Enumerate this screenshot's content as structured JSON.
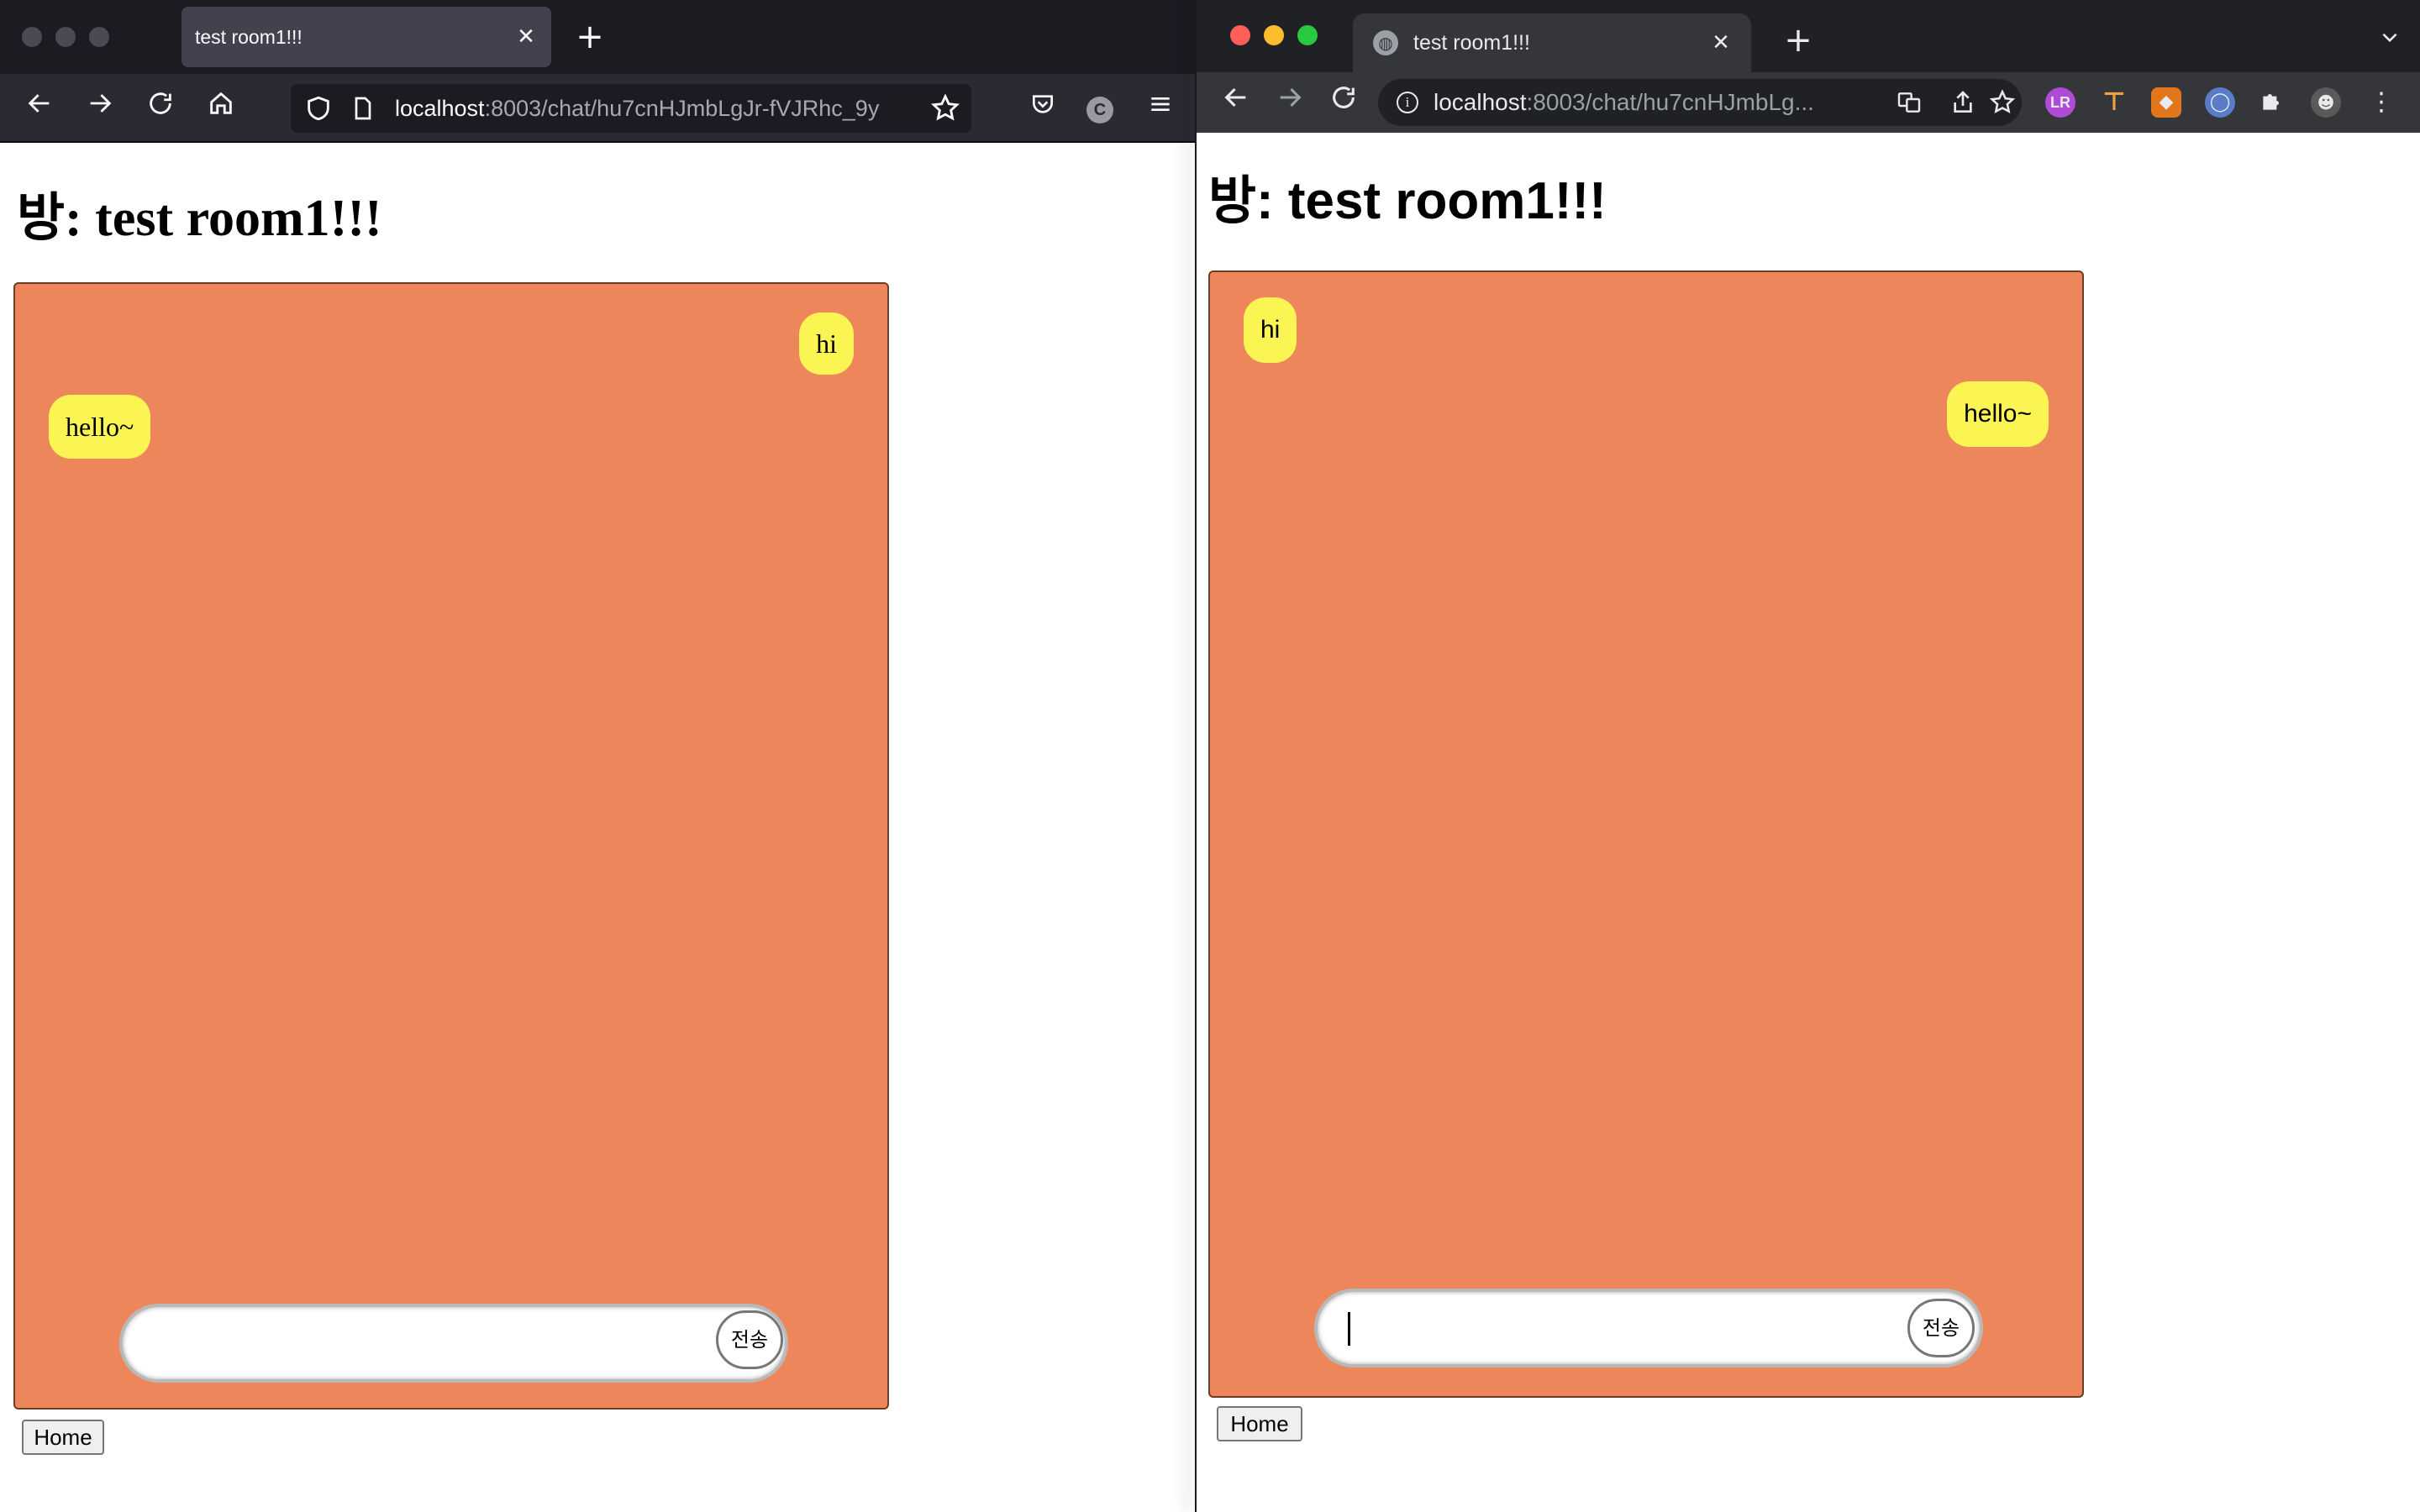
{
  "colors": {
    "chat_background": "#ee865c",
    "bubble": "#fbf554",
    "firefox_chrome": "#2b2a33",
    "chrome_chrome": "#35363a"
  },
  "left_window": {
    "browser": "Firefox",
    "tab": {
      "title": "test room1!!!"
    },
    "toolbar": {
      "url_host": "localhost",
      "url_path": ":8003/chat/hu7cnHJmbLgJr-fVJRhc_9y",
      "icons": [
        "back-icon",
        "forward-icon",
        "reload-icon",
        "home-icon",
        "shield-icon",
        "page-icon",
        "star-icon",
        "pocket-icon",
        "account-icon",
        "menu-icon"
      ]
    },
    "page": {
      "heading": "방: test room1!!!",
      "messages": [
        {
          "text": "hi",
          "align": "right"
        },
        {
          "text": "hello~",
          "align": "left"
        }
      ],
      "input_value": "",
      "send_label": "전송",
      "home_label": "Home"
    }
  },
  "right_window": {
    "browser": "Chrome",
    "tab": {
      "title": "test room1!!!"
    },
    "toolbar": {
      "url_host": "localhost",
      "url_path": ":8003/chat/hu7cnHJmbLg...",
      "icons": [
        "back-icon",
        "forward-icon",
        "reload-icon",
        "info-icon",
        "translate-icon",
        "share-icon",
        "star-icon",
        "extension-lr-icon",
        "extension-flag-icon",
        "metamask-icon",
        "extension-circle-icon",
        "puzzle-icon",
        "profile-avatar",
        "menu-icon"
      ]
    },
    "page": {
      "heading": "방: test room1!!!",
      "messages": [
        {
          "text": "hi",
          "align": "left"
        },
        {
          "text": "hello~",
          "align": "right"
        }
      ],
      "input_value": "",
      "send_label": "전송",
      "home_label": "Home"
    }
  }
}
